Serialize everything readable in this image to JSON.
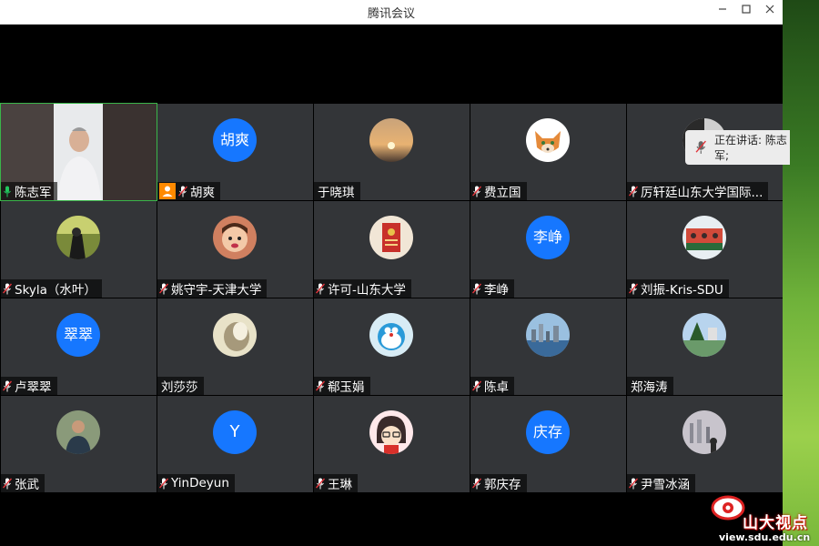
{
  "window": {
    "title": "腾讯会议"
  },
  "speaking": {
    "text": "正在讲话: 陈志军;"
  },
  "watermark": {
    "text": "山大视点",
    "url": "view.sdu.edu.cn"
  },
  "participants": [
    {
      "name": "陈志军",
      "avatar": "video",
      "mic": "active"
    },
    {
      "name": "胡爽",
      "avatar": "text",
      "avatar_text": "胡爽",
      "mic": "muted",
      "badge": "host"
    },
    {
      "name": "于晓琪",
      "avatar": "sunset",
      "mic": "none"
    },
    {
      "name": "费立国",
      "avatar": "fox",
      "mic": "muted"
    },
    {
      "name": "厉轩廷山东大学国际...",
      "avatar": "dark",
      "mic": "muted"
    },
    {
      "name": "Skyla（水叶）",
      "avatar": "photo1",
      "mic": "muted"
    },
    {
      "name": "姚守宇-天津大学",
      "avatar": "child",
      "mic": "muted"
    },
    {
      "name": "许可-山东大学",
      "avatar": "card",
      "mic": "muted"
    },
    {
      "name": "李峥",
      "avatar": "text",
      "avatar_text": "李峥",
      "mic": "muted"
    },
    {
      "name": "刘振-Kris-SDU",
      "avatar": "group",
      "mic": "muted"
    },
    {
      "name": "卢翠翠",
      "avatar": "text",
      "avatar_text": "翠翠",
      "mic": "muted"
    },
    {
      "name": "刘莎莎",
      "avatar": "blur",
      "mic": "none"
    },
    {
      "name": "郗玉娟",
      "avatar": "doraemon",
      "mic": "muted"
    },
    {
      "name": "陈卓",
      "avatar": "city",
      "mic": "muted"
    },
    {
      "name": "郑海涛",
      "avatar": "lake",
      "mic": "none"
    },
    {
      "name": "张武",
      "avatar": "man",
      "mic": "muted"
    },
    {
      "name": "YinDeyun",
      "avatar": "text",
      "avatar_text": "Y",
      "mic": "muted"
    },
    {
      "name": "王琳",
      "avatar": "cartoon",
      "mic": "muted"
    },
    {
      "name": "郭庆存",
      "avatar": "text",
      "avatar_text": "庆存",
      "mic": "muted"
    },
    {
      "name": "尹雪冰涵",
      "avatar": "skyline",
      "mic": "muted"
    }
  ],
  "colors": {
    "accent": "#1677ff",
    "host_badge": "#ff8a00",
    "muted_mic": "#e0343a",
    "active_mic": "#22c55e"
  }
}
